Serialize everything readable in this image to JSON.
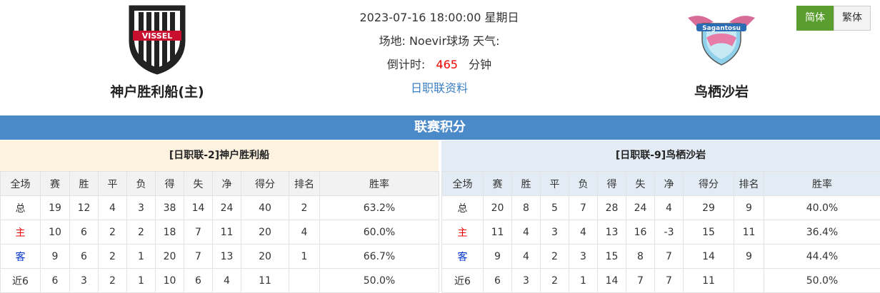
{
  "match": {
    "datetime": "2023-07-16 18:00:00 星期日",
    "venue_weather": "场地: Noevir球场 天气:",
    "countdown_label": "倒计时:",
    "countdown_value": "465",
    "countdown_unit": "分钟",
    "league_link": "日职联资料"
  },
  "home_team": {
    "name": "神户胜利船(主)",
    "logo_text": "VISSEL"
  },
  "away_team": {
    "name": "鸟栖沙岩",
    "logo_text": "Sagantosu"
  },
  "lang": {
    "simplified": "简体",
    "traditional": "繁体"
  },
  "section_title": "联赛积分",
  "columns": [
    "全场",
    "赛",
    "胜",
    "平",
    "负",
    "得",
    "失",
    "净",
    "得分",
    "排名",
    "胜率"
  ],
  "home_table": {
    "title": "[日职联-2]神户胜利船",
    "rows": [
      [
        "总",
        "19",
        "12",
        "4",
        "3",
        "38",
        "14",
        "24",
        "40",
        "2",
        "63.2%"
      ],
      [
        "主",
        "10",
        "6",
        "2",
        "2",
        "18",
        "7",
        "11",
        "20",
        "4",
        "60.0%"
      ],
      [
        "客",
        "9",
        "6",
        "2",
        "1",
        "20",
        "7",
        "13",
        "20",
        "1",
        "66.7%"
      ],
      [
        "近6",
        "6",
        "3",
        "2",
        "1",
        "10",
        "6",
        "4",
        "11",
        "",
        "50.0%"
      ]
    ]
  },
  "away_table": {
    "title": "[日职联-9]鸟栖沙岩",
    "rows": [
      [
        "总",
        "20",
        "8",
        "5",
        "7",
        "28",
        "24",
        "4",
        "29",
        "9",
        "40.0%"
      ],
      [
        "主",
        "11",
        "4",
        "3",
        "4",
        "13",
        "16",
        "-3",
        "15",
        "11",
        "36.4%"
      ],
      [
        "客",
        "9",
        "4",
        "2",
        "3",
        "15",
        "8",
        "7",
        "14",
        "9",
        "44.4%"
      ],
      [
        "近6",
        "6",
        "3",
        "2",
        "1",
        "14",
        "7",
        "7",
        "11",
        "",
        "50.0%"
      ]
    ]
  },
  "colors": {
    "header_bar": "#4a8ac9",
    "home_accent": "#e00",
    "away_accent": "#0033cc",
    "active_lang": "#5a9e2f"
  }
}
